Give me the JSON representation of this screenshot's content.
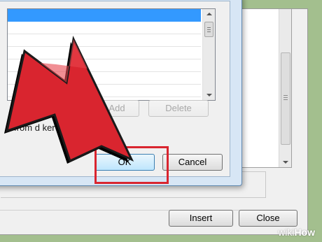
{
  "background_dialog": {
    "insert_button": "Insert",
    "close_button": "Close"
  },
  "dialog": {
    "add_button": "Add",
    "delete_button": "Delete",
    "status_text": "s from d                  ker",
    "ok_button": "OK",
    "cancel_button": "Cancel"
  },
  "watermark": {
    "prefix": "wiki",
    "suffix": "How"
  },
  "colors": {
    "arrow": "#d9252f",
    "highlight": "#d9252f",
    "selection": "#3399ff",
    "background": "#a3bf8e"
  }
}
